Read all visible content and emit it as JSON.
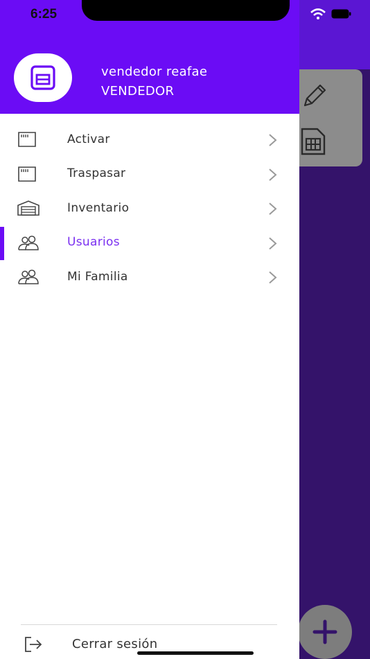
{
  "status_bar": {
    "time": "6:25"
  },
  "user": {
    "name": "vendedor reafae",
    "role": "VENDEDOR"
  },
  "menu": {
    "items": [
      {
        "label": "Activar",
        "icon": "sim-card-icon"
      },
      {
        "label": "Traspasar",
        "icon": "sim-card-icon"
      },
      {
        "label": "Inventario",
        "icon": "warehouse-icon"
      },
      {
        "label": "Usuarios",
        "icon": "users-icon",
        "active": true
      },
      {
        "label": "Mi Familia",
        "icon": "users-icon"
      }
    ]
  },
  "footer": {
    "logout_label": "Cerrar sesión"
  },
  "colors": {
    "brand": "#6b0cf5",
    "active_text": "#7a2ff0",
    "background": "#34136a"
  }
}
